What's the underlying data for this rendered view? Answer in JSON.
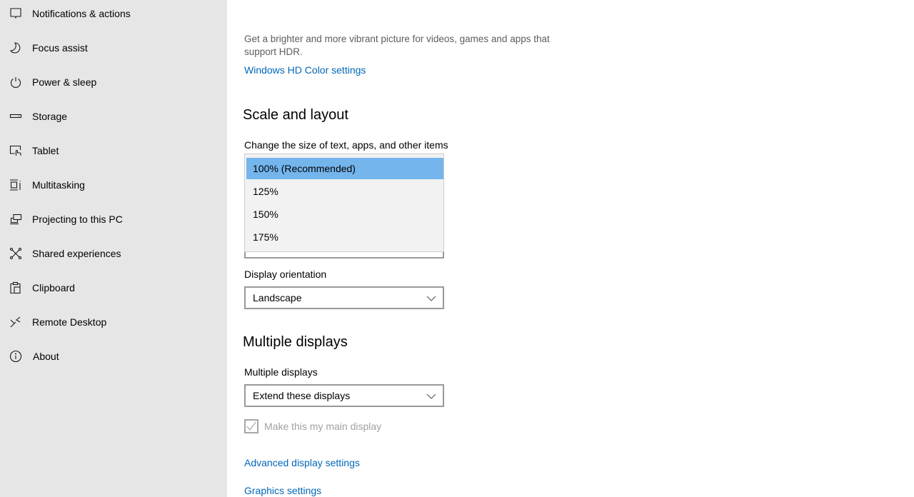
{
  "sidebar": {
    "items": [
      {
        "label": "Notifications & actions",
        "icon": "notification-icon"
      },
      {
        "label": "Focus assist",
        "icon": "moon-icon"
      },
      {
        "label": "Power & sleep",
        "icon": "power-icon"
      },
      {
        "label": "Storage",
        "icon": "storage-icon"
      },
      {
        "label": "Tablet",
        "icon": "tablet-icon"
      },
      {
        "label": "Multitasking",
        "icon": "multitasking-icon"
      },
      {
        "label": "Projecting to this PC",
        "icon": "projecting-icon"
      },
      {
        "label": "Shared experiences",
        "icon": "shared-experiences-icon"
      },
      {
        "label": "Clipboard",
        "icon": "clipboard-icon"
      },
      {
        "label": "Remote Desktop",
        "icon": "remote-desktop-icon"
      },
      {
        "label": "About",
        "icon": "info-icon"
      }
    ]
  },
  "hdr": {
    "description": "Get a brighter and more vibrant picture for videos, games and apps that support HDR.",
    "link": "Windows HD Color settings"
  },
  "scale_layout": {
    "title": "Scale and layout",
    "scale_label": "Change the size of text, apps, and other items",
    "scale_options": [
      "100% (Recommended)",
      "125%",
      "150%",
      "175%"
    ],
    "scale_selected": "100% (Recommended)",
    "orientation_label": "Display orientation",
    "orientation_value": "Landscape"
  },
  "multiple_displays": {
    "title": "Multiple displays",
    "label": "Multiple displays",
    "value": "Extend these displays",
    "main_display_checkbox": "Make this my main display",
    "main_display_checked": true,
    "main_display_disabled": true
  },
  "links": {
    "advanced": "Advanced display settings",
    "graphics": "Graphics settings"
  },
  "colors": {
    "accent_link": "#0067b8",
    "dropdown_selected": "#74b5ec",
    "sidebar_bg": "#e6e6e6"
  }
}
